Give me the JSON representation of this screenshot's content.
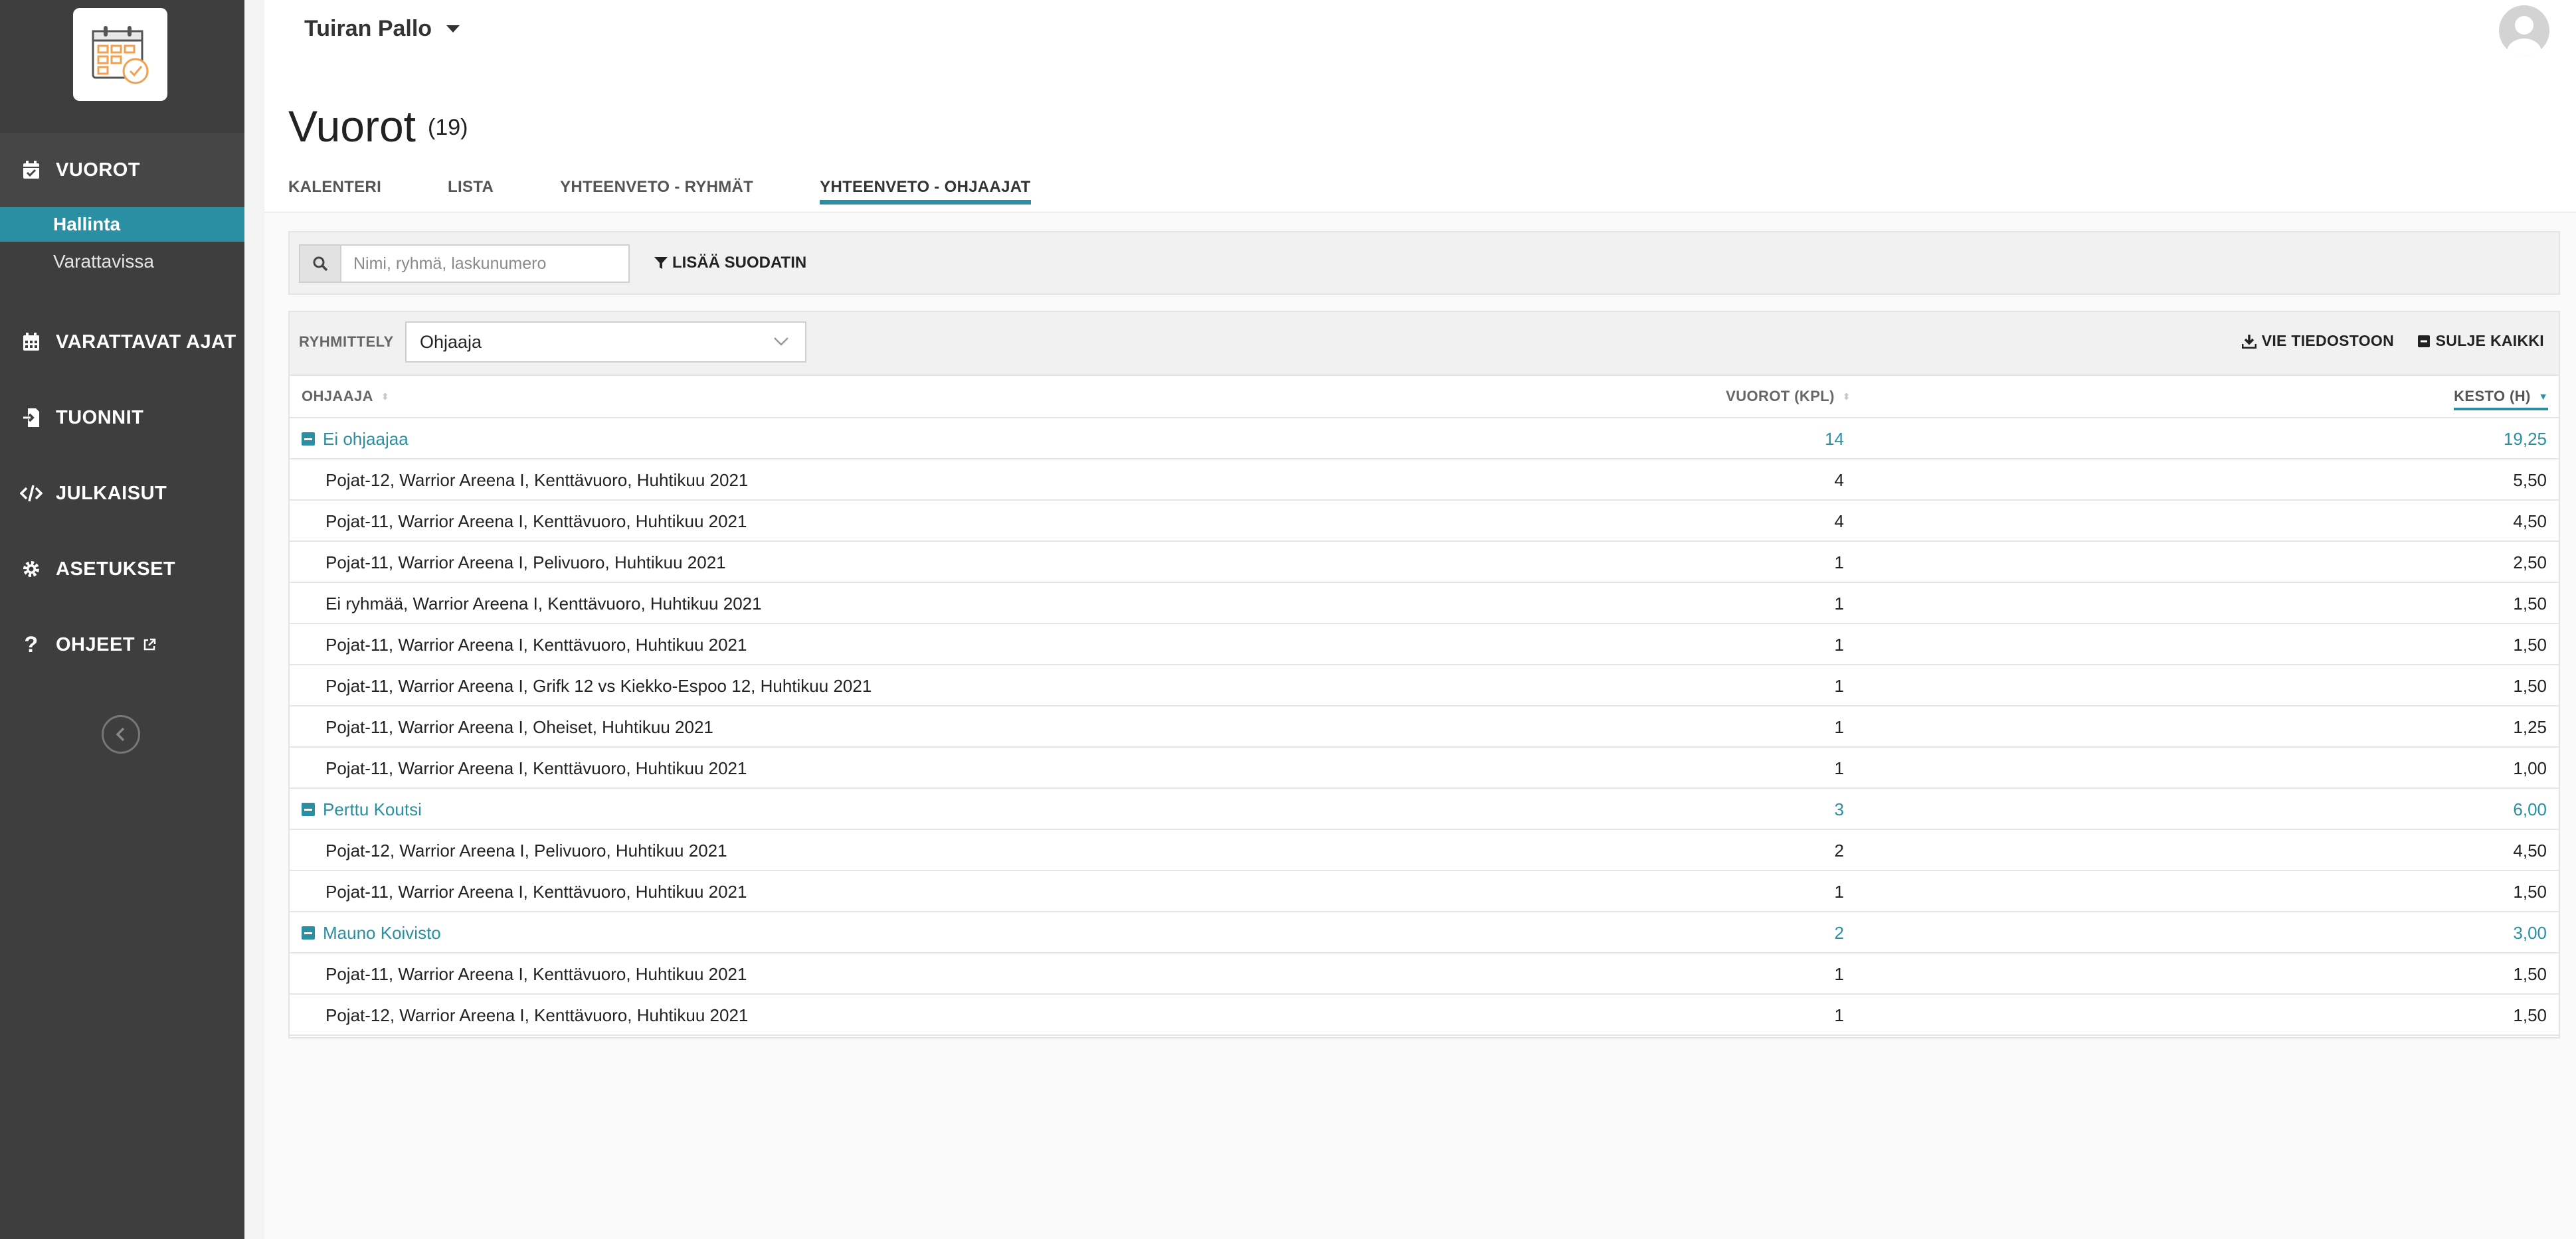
{
  "sidebar": {
    "nav": [
      {
        "label": "VUOROT",
        "icon": "calendar-check-icon"
      },
      {
        "label": "VARATTAVAT AJAT",
        "icon": "calendar-grid-icon"
      },
      {
        "label": "TUONNIT",
        "icon": "file-import-icon"
      },
      {
        "label": "JULKAISUT",
        "icon": "code-icon"
      },
      {
        "label": "ASETUKSET",
        "icon": "gear-icon"
      },
      {
        "label": "OHJEET",
        "icon": "question-icon"
      }
    ],
    "sub_items": [
      {
        "label": "Hallinta",
        "active": true
      },
      {
        "label": "Varattavissa",
        "active": false
      }
    ]
  },
  "topbar": {
    "org_name": "Tuiran Pallo"
  },
  "page": {
    "title": "Vuorot",
    "count": "(19)",
    "tabs": [
      "KALENTERI",
      "LISTA",
      "YHTEENVETO - RYHMÄT",
      "YHTEENVETO - OHJAAJAT"
    ],
    "active_tab": 3
  },
  "search": {
    "placeholder": "Nimi, ryhmä, laskunumero",
    "filter_label": "LISÄÄ SUODATIN"
  },
  "toolbar": {
    "group_label": "RYHMITTELY",
    "group_value": "Ohjaaja",
    "export_label": "VIE TIEDOSTOON",
    "close_all_label": "SULJE KAIKKI"
  },
  "table": {
    "columns": [
      "OHJAAJA",
      "VUOROT (KPL)",
      "KESTO (H)"
    ],
    "groups": [
      {
        "name": "Ei ohjaajaa",
        "count": "14",
        "hours": "19,25",
        "rows": [
          {
            "name": "Pojat-12, Warrior Areena I, Kenttävuoro, Huhtikuu 2021",
            "count": "4",
            "hours": "5,50"
          },
          {
            "name": "Pojat-11, Warrior Areena I, Kenttävuoro, Huhtikuu 2021",
            "count": "4",
            "hours": "4,50"
          },
          {
            "name": "Pojat-11, Warrior Areena I, Pelivuoro, Huhtikuu 2021",
            "count": "1",
            "hours": "2,50"
          },
          {
            "name": "Ei ryhmää, Warrior Areena I, Kenttävuoro, Huhtikuu 2021",
            "count": "1",
            "hours": "1,50"
          },
          {
            "name": "Pojat-11, Warrior Areena I, Kenttävuoro, Huhtikuu 2021",
            "count": "1",
            "hours": "1,50"
          },
          {
            "name": "Pojat-11, Warrior Areena I, Grifk 12 vs Kiekko-Espoo 12, Huhtikuu 2021",
            "count": "1",
            "hours": "1,50"
          },
          {
            "name": "Pojat-11, Warrior Areena I, Oheiset, Huhtikuu 2021",
            "count": "1",
            "hours": "1,25"
          },
          {
            "name": "Pojat-11, Warrior Areena I, Kenttävuoro, Huhtikuu 2021",
            "count": "1",
            "hours": "1,00"
          }
        ]
      },
      {
        "name": "Perttu Koutsi",
        "count": "3",
        "hours": "6,00",
        "rows": [
          {
            "name": "Pojat-12, Warrior Areena I, Pelivuoro, Huhtikuu 2021",
            "count": "2",
            "hours": "4,50"
          },
          {
            "name": "Pojat-11, Warrior Areena I, Kenttävuoro, Huhtikuu 2021",
            "count": "1",
            "hours": "1,50"
          }
        ]
      },
      {
        "name": "Mauno Koivisto",
        "count": "2",
        "hours": "3,00",
        "rows": [
          {
            "name": "Pojat-11, Warrior Areena I, Kenttävuoro, Huhtikuu 2021",
            "count": "1",
            "hours": "1,50"
          },
          {
            "name": "Pojat-12, Warrior Areena I, Kenttävuoro, Huhtikuu 2021",
            "count": "1",
            "hours": "1,50"
          }
        ]
      }
    ]
  },
  "colors": {
    "accent": "#2a8fa3",
    "sidebar": "#3e3e3e"
  }
}
